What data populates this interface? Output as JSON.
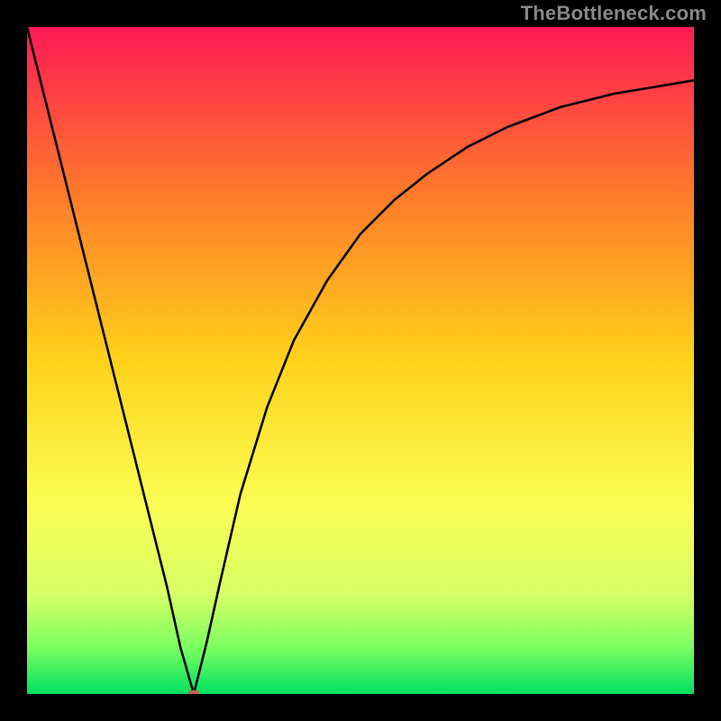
{
  "watermark": "TheBottleneck.com",
  "chart_data": {
    "type": "line",
    "title": "",
    "xlabel": "",
    "ylabel": "",
    "xlim": [
      0,
      100
    ],
    "ylim": [
      0,
      100
    ],
    "grid": false,
    "legend": false,
    "colors": {
      "gradient_top": "#ff1a55",
      "gradient_upper_mid": "#ff7a2a",
      "gradient_mid": "#ffd21a",
      "gradient_lower_mid": "#faff55",
      "gradient_near_bottom": "#d8ff66",
      "gradient_bottom": "#00e060",
      "curve": "#000000",
      "marker": "#c85a5a"
    },
    "bottleneck_point": {
      "x": 25,
      "y": 0
    },
    "series": [
      {
        "name": "bottleneck-curve",
        "x": [
          0,
          3,
          6,
          9,
          12,
          15,
          18,
          21,
          23,
          25,
          27,
          29,
          32,
          36,
          40,
          45,
          50,
          55,
          60,
          66,
          72,
          80,
          88,
          94,
          100
        ],
        "y": [
          100,
          88,
          76,
          64,
          52,
          40,
          28,
          16,
          7,
          0,
          8,
          17,
          30,
          43,
          53,
          62,
          69,
          74,
          78,
          82,
          85,
          88,
          90,
          91,
          92
        ]
      }
    ],
    "gradient_stops_pct": [
      0,
      25,
      50,
      72,
      85,
      93,
      100
    ]
  }
}
